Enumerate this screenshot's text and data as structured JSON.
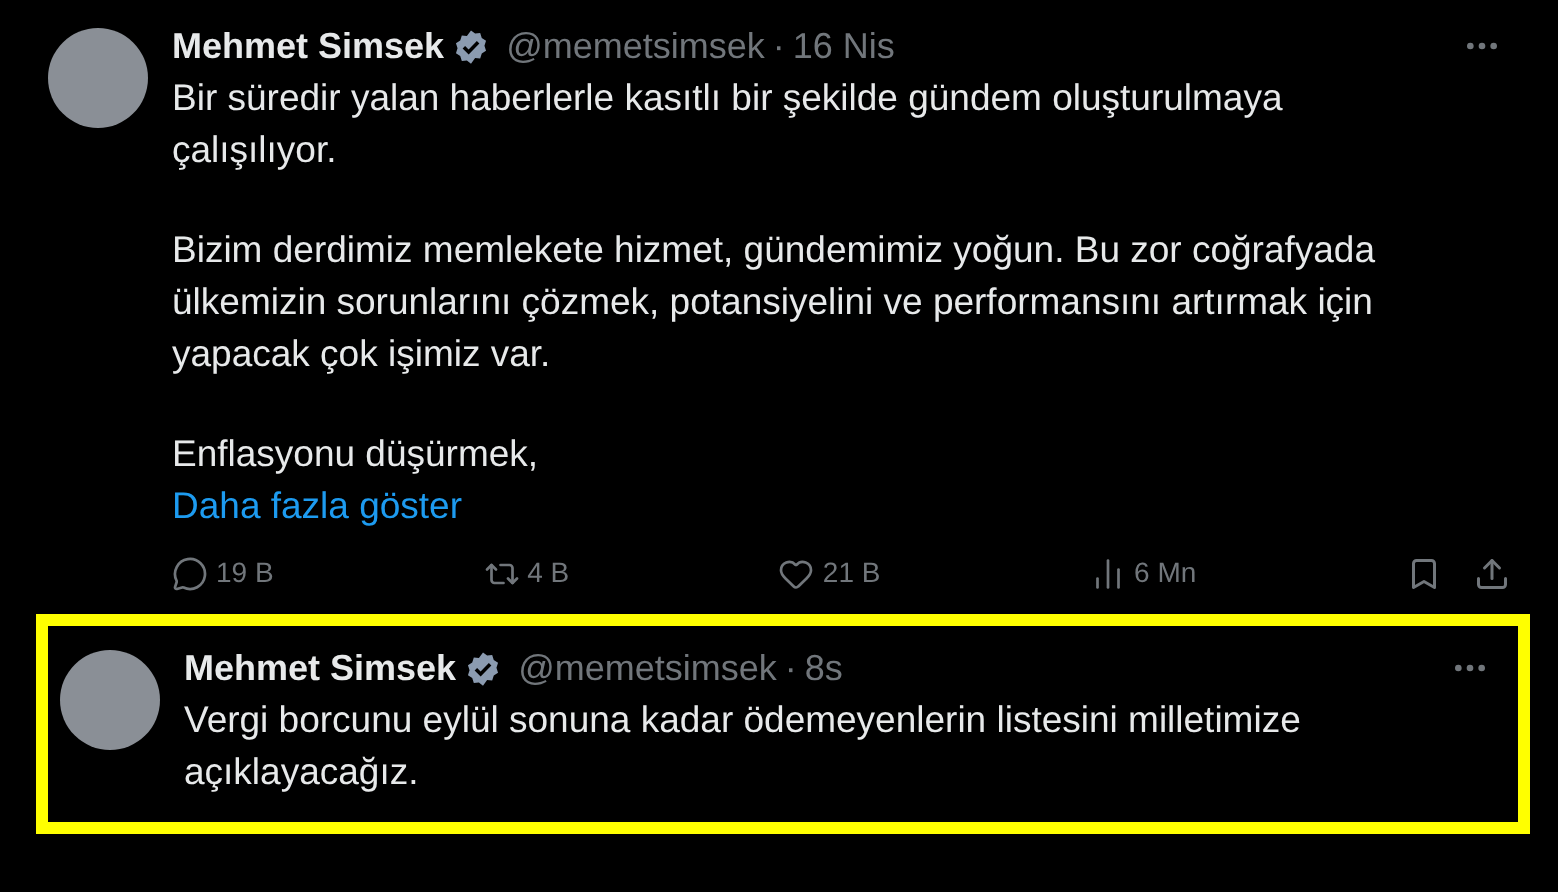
{
  "tweets": [
    {
      "name": "Mehmet Simsek",
      "handle": "@memetsimsek",
      "separator": "·",
      "time": "16 Nis",
      "paragraphs": [
        "Bir süredir yalan haberlerle kasıtlı bir şekilde gündem oluşturulmaya çalışılıyor.",
        "Bizim derdimiz memlekete hizmet, gündemimiz yoğun. Bu zor coğrafyada ülkemizin sorunlarını çözmek, potansiyelini ve performansını artırmak için yapacak çok işimiz var.",
        "Enflasyonu düşürmek,"
      ],
      "show_more": "Daha fazla göster",
      "actions": {
        "replies": "19 B",
        "reposts": "4 B",
        "likes": "21 B",
        "views": "6 Mn"
      },
      "highlighted": false
    },
    {
      "name": "Mehmet Simsek",
      "handle": "@memetsimsek",
      "separator": "·",
      "time": "8s",
      "paragraphs": [
        "Vergi borcunu eylül sonuna kadar ödemeyenlerin listesini milletimize açıklayacağız."
      ],
      "highlighted": true
    }
  ]
}
